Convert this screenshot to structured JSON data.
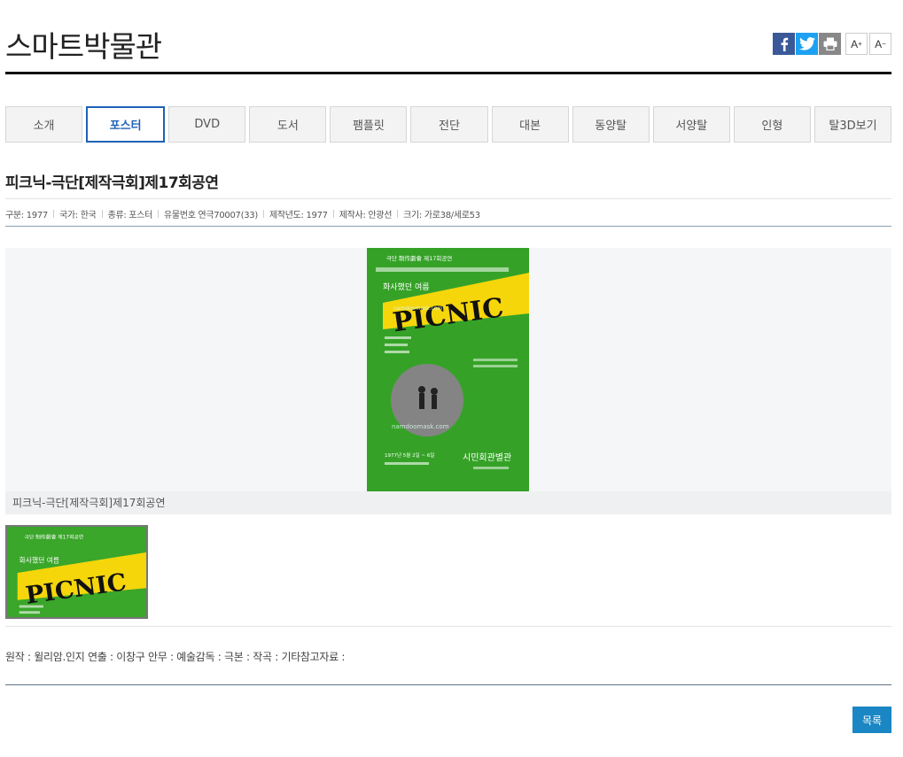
{
  "header": {
    "title": "스마트박물관",
    "share": {
      "facebook_icon": "facebook-icon",
      "twitter_icon": "twitter-icon",
      "print_icon": "print-icon"
    },
    "font_up_label": "A",
    "font_down_label": "A"
  },
  "tabs": [
    {
      "label": "소개",
      "active": false
    },
    {
      "label": "포스터",
      "active": true
    },
    {
      "label": "DVD",
      "active": false
    },
    {
      "label": "도서",
      "active": false
    },
    {
      "label": "팸플릿",
      "active": false
    },
    {
      "label": "전단",
      "active": false
    },
    {
      "label": "대본",
      "active": false
    },
    {
      "label": "동양탈",
      "active": false
    },
    {
      "label": "서양탈",
      "active": false
    },
    {
      "label": "인형",
      "active": false
    },
    {
      "label": "탈3D보기",
      "active": false
    }
  ],
  "item": {
    "title": "피크닉-극단[제작극회]제17회공연",
    "meta": [
      "구분: 1977",
      "국가: 한국",
      "종류: 포스터",
      "유물번호 연극70007(33)",
      "제작년도: 1977",
      "제작사: 안광선",
      "크기: 가로38/세로53"
    ],
    "caption": "피크닉-극단[제작극회]제17회공연",
    "description": "원작 : 윌리암.인지 연출 : 이창구 안무 : 예술감독 : 극본 : 작곡 : 기타참고자료 :"
  },
  "poster": {
    "header_text": "극단 制作劇會 제17회공연",
    "sub_text": "화사했던 여름",
    "title": "PICNIC",
    "date_text": "1977년 5월 2일 ~ 6일",
    "venue": "시민회관별관",
    "watermark": "namdoomask.com",
    "green": "#3aa62a",
    "yellow": "#f5d60a"
  },
  "footer": {
    "list_button": "목록"
  },
  "colors": {
    "accent": "#1e62b4",
    "button": "#1a86c3"
  }
}
